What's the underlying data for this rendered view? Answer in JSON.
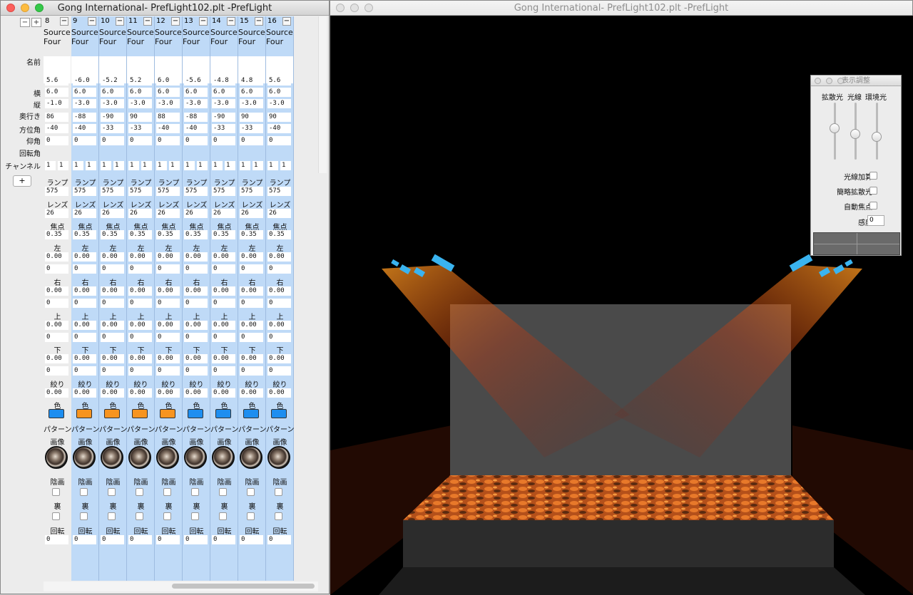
{
  "left_window": {
    "title": "Gong International- PrefLight102.plt -PrefLight",
    "minus": "−",
    "plus": "+",
    "add_channel": "+",
    "row_labels": {
      "name": "名前",
      "x": "横",
      "y": "縦",
      "z": "奥行き",
      "azimuth": "方位角",
      "elevation": "仰角",
      "rotation": "回転角",
      "channel": "チャンネル"
    },
    "columns": [
      {
        "num": "8",
        "source": "Source Four",
        "x": "5.6",
        "y": "6.0",
        "z": "-1.0",
        "azimuth": "86",
        "elevation": "-40",
        "rotation": "0",
        "color": "#1e8ef0"
      },
      {
        "num": "9",
        "source": "Source Four",
        "x": "-6.0",
        "y": "6.0",
        "z": "-3.0",
        "azimuth": "-88",
        "elevation": "-40",
        "rotation": "0",
        "color": "#f79420"
      },
      {
        "num": "10",
        "source": "Source Four",
        "x": "-5.2",
        "y": "6.0",
        "z": "-3.0",
        "azimuth": "-90",
        "elevation": "-33",
        "rotation": "0",
        "color": "#f79420"
      },
      {
        "num": "11",
        "source": "Source Four",
        "x": "5.2",
        "y": "6.0",
        "z": "-3.0",
        "azimuth": "90",
        "elevation": "-33",
        "rotation": "0",
        "color": "#f79420"
      },
      {
        "num": "12",
        "source": "Source Four",
        "x": "6.0",
        "y": "6.0",
        "z": "-3.0",
        "azimuth": "88",
        "elevation": "-40",
        "rotation": "0",
        "color": "#f79420"
      },
      {
        "num": "13",
        "source": "Source Four",
        "x": "-5.6",
        "y": "6.0",
        "z": "-3.0",
        "azimuth": "-88",
        "elevation": "-40",
        "rotation": "0",
        "color": "#1e8ef0"
      },
      {
        "num": "14",
        "source": "Source Four",
        "x": "-4.8",
        "y": "6.0",
        "z": "-3.0",
        "azimuth": "-90",
        "elevation": "-33",
        "rotation": "0",
        "color": "#1e8ef0"
      },
      {
        "num": "15",
        "source": "Source Four",
        "x": "4.8",
        "y": "6.0",
        "z": "-3.0",
        "azimuth": "90",
        "elevation": "-33",
        "rotation": "0",
        "color": "#1e8ef0"
      },
      {
        "num": "16",
        "source": "Source Four",
        "x": "5.6",
        "y": "6.0",
        "z": "-3.0",
        "azimuth": "90",
        "elevation": "-40",
        "rotation": "0",
        "color": "#1e8ef0"
      }
    ],
    "common": {
      "channel_a": "1",
      "channel_b": "1",
      "lamp_label": "ランプ",
      "lamp": "575",
      "lens_label": "レンズ",
      "lens": "26",
      "focus_label": "焦点",
      "focus": "0.35",
      "left_label": "左",
      "left_val": "0.00",
      "left_sub": "0",
      "right_label": "右",
      "right_val": "0.00",
      "right_sub": "0",
      "top_label": "上",
      "top_val": "0.00",
      "top_sub": "0",
      "bottom_label": "下",
      "bottom_val": "0.00",
      "bottom_sub": "0",
      "iris_label": "絞り",
      "iris": "0.00",
      "color_label": "色",
      "pattern_label": "パターン",
      "image_label": "画像",
      "shade_label": "陰画",
      "back_label": "裏",
      "rot_label": "回転",
      "rot": "0"
    }
  },
  "right_window": {
    "title": "Gong International- PrefLight102.plt -PrefLight"
  },
  "display_panel": {
    "title": "表示調整",
    "slider_labels": [
      "拡散光",
      "光線",
      "環境光"
    ],
    "slider_levels": [
      0.55,
      0.45,
      0.4
    ],
    "ray_add": "光線加算",
    "simple_diffuse": "簡略拡散光",
    "auto_focus": "自動焦点",
    "sensitivity_label": "感度",
    "sensitivity": "0"
  }
}
